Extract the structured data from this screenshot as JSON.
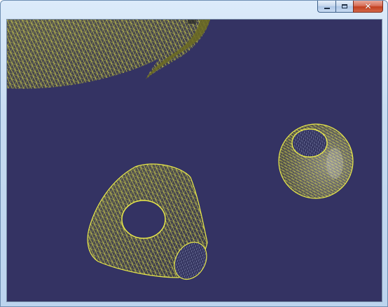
{
  "window": {
    "title": "",
    "controls": {
      "minimize_icon": "minimize-icon",
      "maximize_icon": "maximize-icon",
      "close_icon": "close-icon",
      "close_glyph": "✕"
    }
  },
  "viewport": {
    "background_color": "#343363",
    "mesh_color": "#e8e84a",
    "shaded_color": "#6b6a22",
    "objects": [
      {
        "name": "swept-surface-top-left",
        "render": "wireframe"
      },
      {
        "name": "truncated-cone-with-hole",
        "render": "wireframe"
      },
      {
        "name": "hollow-sphere",
        "render": "wireframe"
      }
    ]
  }
}
